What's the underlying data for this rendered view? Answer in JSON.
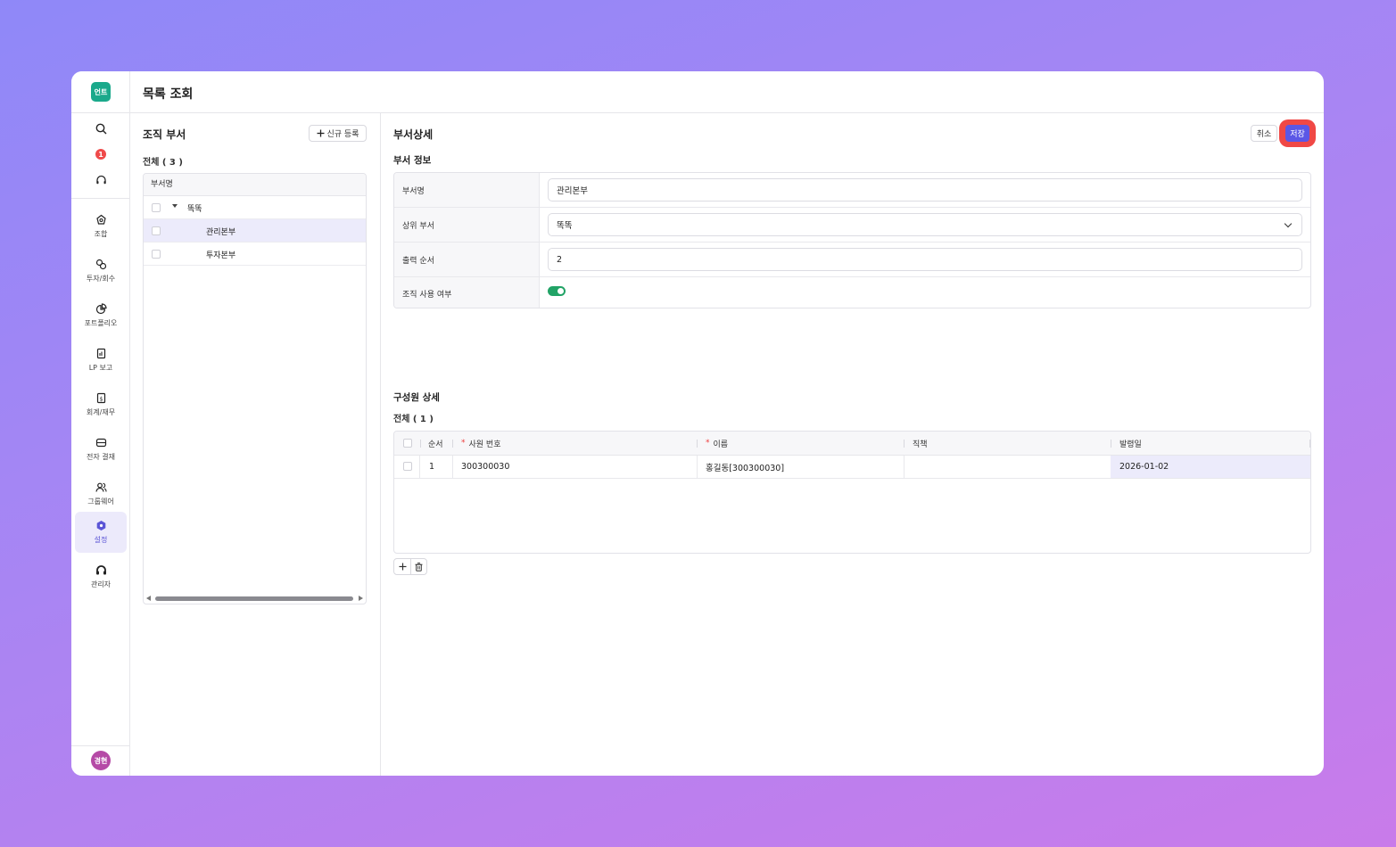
{
  "app": {
    "logo_text": "언트",
    "page_title": "목록 조회"
  },
  "sidebar": {
    "notification_count": "1",
    "items": [
      {
        "label": "조합",
        "icon": "union-icon"
      },
      {
        "label": "투자/회수",
        "icon": "investment-icon"
      },
      {
        "label": "포트폴리오",
        "icon": "portfolio-icon"
      },
      {
        "label": "LP 보고",
        "icon": "report-icon"
      },
      {
        "label": "회계/재무",
        "icon": "accounting-icon"
      },
      {
        "label": "전자 결재",
        "icon": "approval-icon"
      },
      {
        "label": "그룹웨어",
        "icon": "groupware-icon"
      },
      {
        "label": "설정",
        "icon": "settings-icon",
        "active": true
      },
      {
        "label": "관리자",
        "icon": "admin-icon"
      }
    ],
    "avatar_text": "경현"
  },
  "org": {
    "title": "조직 부서",
    "new_button": "신규 등록",
    "count_label": "전체 ( 3 )",
    "column_header": "부서명",
    "tree": [
      {
        "name": "똑똑",
        "level": 0,
        "expanded": true
      },
      {
        "name": "관리본부",
        "level": 1,
        "selected": true
      },
      {
        "name": "투자본부",
        "level": 1
      }
    ]
  },
  "detail": {
    "title": "부서상세",
    "cancel_label": "취소",
    "save_label": "저장",
    "info_section": "부서 정보",
    "fields": {
      "dept_name_label": "부서명",
      "dept_name_value": "관리본부",
      "parent_label": "상위 부서",
      "parent_value": "똑똑",
      "order_label": "출력 순서",
      "order_value": "2",
      "use_label": "조직 사용 여부",
      "use_value": true
    },
    "members_section": "구성원 상세",
    "members_count": "전체 ( 1 )",
    "columns": {
      "order": "순서",
      "emp_no": "사원 번호",
      "name": "이름",
      "position": "직책",
      "issue_date": "발령일"
    },
    "members": [
      {
        "order": "1",
        "emp_no": "300300030",
        "name": "홍길동[300300030]",
        "position": "",
        "issue_date": "2026-01-02"
      }
    ]
  },
  "colors": {
    "accent": "#5b57e6",
    "highlight": "#f04845",
    "toggle_on": "#21a366",
    "logo": "#1aa98b",
    "selected_row": "#ecebfb"
  }
}
